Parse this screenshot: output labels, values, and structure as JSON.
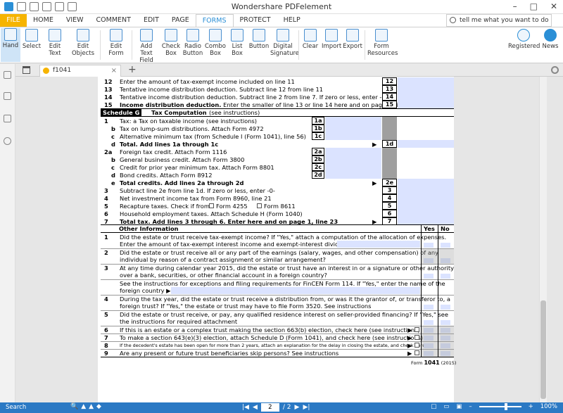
{
  "app": {
    "title": "Wondershare PDFelement"
  },
  "menu": {
    "file": "FILE",
    "items": [
      "HOME",
      "VIEW",
      "COMMENT",
      "EDIT",
      "PAGE",
      "FORMS",
      "PROTECT",
      "HELP"
    ],
    "active": "FORMS"
  },
  "tellme": {
    "placeholder": "tell me what you want to do"
  },
  "ribbon": {
    "hand": "Hand",
    "select": "Select",
    "edit_text": "Edit Text",
    "edit_objects": "Edit Objects",
    "edit_form": "Edit Form",
    "add_text_field": "Add Text Field",
    "check_box": "Check Box",
    "radio_button": "Radio Button",
    "combo_box": "Combo Box",
    "list_box": "List Box",
    "button": "Button",
    "digital_signature": "Digital Signature",
    "clear": "Clear",
    "import": "Import",
    "export": "Export",
    "form_resources": "Form Resources",
    "registered": "Registered",
    "news": "News"
  },
  "tab": {
    "name": "f1041"
  },
  "status": {
    "search": "Search",
    "page": "2",
    "total": "/ 2",
    "zoom": "100%"
  },
  "form": {
    "top": [
      {
        "n": "12",
        "t": "Enter the amount of tax-exempt income included on line 11",
        "box": "12",
        "bold": false
      },
      {
        "n": "13",
        "t": "Tentative income distribution deduction. Subtract line 12 from line 11",
        "box": "13",
        "bold": false
      },
      {
        "n": "14",
        "t": "Tentative income distribution deduction. Subtract line 2 from line 7. If zero or less, enter -0-",
        "box": "14",
        "bold": false
      },
      {
        "n": "15",
        "t": "Income distribution deduction.",
        "t2": " Enter the smaller of line 13 or line 14 here and on page 1, line 18",
        "box": "15",
        "bold": true
      }
    ],
    "schedG": {
      "label": "Schedule G",
      "title": "Tax Computation",
      "sub": "(see instructions)"
    },
    "g": [
      {
        "n": "1",
        "t": "Tax: a  Tax on taxable income (see instructions)",
        "box": "1a"
      },
      {
        "n": "b",
        "t": "Tax on lump-sum distributions. Attach Form 4972",
        "box": "1b"
      },
      {
        "n": "c",
        "t": "Alternative minimum tax (from Schedule I (Form 1041), line 56)",
        "box": "1c"
      },
      {
        "n": "d",
        "t": "Total. Add lines 1a through 1c",
        "box": "1d"
      },
      {
        "n": "2a",
        "t": "Foreign tax credit. Attach Form 1116",
        "box": "2a"
      },
      {
        "n": "b",
        "t": "General business credit. Attach Form 3800",
        "box": "2b"
      },
      {
        "n": "c",
        "t": "Credit for prior year minimum tax. Attach Form 8801",
        "box": "2c"
      },
      {
        "n": "d",
        "t": "Bond credits. Attach Form 8912",
        "box": "2d"
      },
      {
        "n": "e",
        "t": "Total credits. Add lines 2a through 2d",
        "box": "2e"
      },
      {
        "n": "3",
        "t": "Subtract line 2e from line 1d. If zero or less, enter -0-",
        "box": "3"
      },
      {
        "n": "4",
        "t": "Net investment income tax from Form 8960, line 21",
        "box": "4"
      },
      {
        "n": "5",
        "t": "Recapture taxes. Check if from:",
        "c1": "Form 4255",
        "c2": "Form 8611",
        "box": "5"
      },
      {
        "n": "6",
        "t": "Household employment taxes. Attach Schedule H (Form 1040)",
        "box": "6"
      },
      {
        "n": "7",
        "t": "Total tax. Add lines 3 through 6. Enter here and on page 1, line 23",
        "box": "7"
      }
    ],
    "other": {
      "title": "Other Information",
      "yes": "Yes",
      "no": "No"
    },
    "q": [
      {
        "n": "1",
        "l1": "Did the estate or trust receive tax-exempt income? If \"Yes,\" attach a computation of the allocation of expenses.",
        "l2": "Enter the amount of tax-exempt interest income and exempt-interest dividends ▶ $"
      },
      {
        "n": "2",
        "l1": "Did the estate or trust receive all or any part of the earnings (salary, wages, and other compensation) of any",
        "l2": "individual by reason of a contract assignment or similar arrangement?"
      },
      {
        "n": "3",
        "l1": "At any time during calendar year 2015, did the estate or trust have an interest in or a signature or other authority",
        "l2": "over a bank, securities, or other financial account in a foreign country?"
      },
      {
        "n": "",
        "l1": "See the instructions for exceptions and filing requirements for FinCEN Form 114. If \"Yes,\" enter the name of the",
        "l2": "foreign country ▶"
      },
      {
        "n": "4",
        "l1": "During the tax year, did the estate or trust receive a distribution from, or was it the grantor of, or transferor to, a",
        "l2": "foreign trust? If \"Yes,\" the estate or trust may have to file Form 3520. See instructions"
      },
      {
        "n": "5",
        "l1": "Did the estate or trust receive, or pay, any qualified residence interest on seller-provided financing? If \"Yes,\" see",
        "l2": "the instructions for required attachment"
      },
      {
        "n": "6",
        "l1": "If this is an estate or a complex trust making the section 663(b) election, check here (see instructions)",
        "l2": ""
      },
      {
        "n": "7",
        "l1": "To make a section 643(e)(3) election, attach Schedule D (Form 1041), and check here (see instructions)",
        "l2": ""
      },
      {
        "n": "8",
        "l1": "If the decedent's estate has been open for more than 2 years, attach an explanation for the delay in closing the estate, and check here",
        "l2": ""
      },
      {
        "n": "9",
        "l1": "Are any present or future trust beneficiaries skip persons? See instructions",
        "l2": ""
      }
    ],
    "footer": {
      "form": "Form",
      "num": "1041",
      "year": "(2015)"
    }
  }
}
